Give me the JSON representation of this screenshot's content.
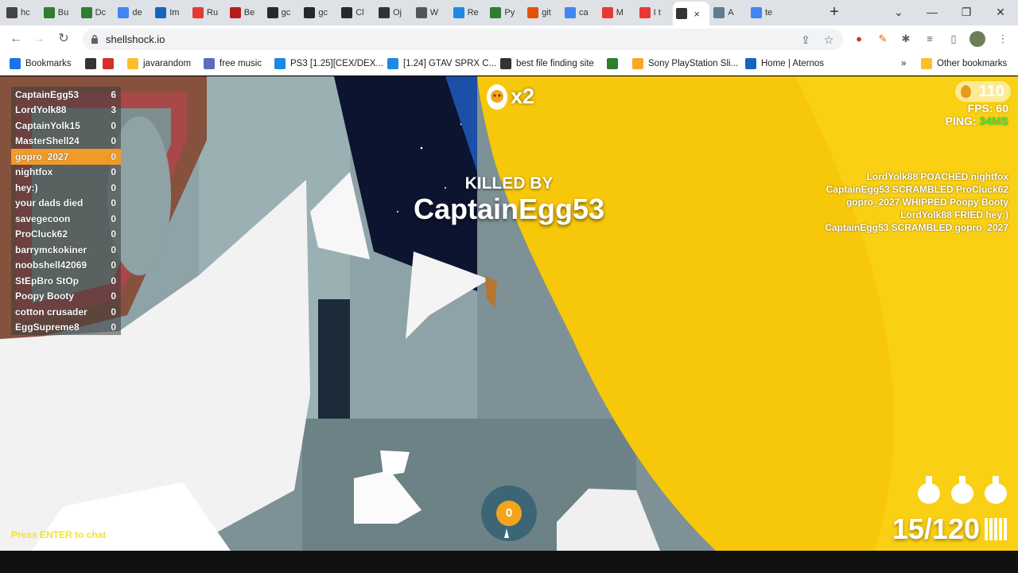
{
  "browser": {
    "tabs": [
      {
        "label": "hc",
        "color": "#444"
      },
      {
        "label": "Bu",
        "color": "#2e7d32"
      },
      {
        "label": "Dc",
        "color": "#2e7d32"
      },
      {
        "label": "de",
        "color": "#4285f4"
      },
      {
        "label": "Im",
        "color": "#1565c0"
      },
      {
        "label": "Ru",
        "color": "#e53935"
      },
      {
        "label": "Be",
        "color": "#b71c1c"
      },
      {
        "label": "gc",
        "color": "#24292e"
      },
      {
        "label": "gc",
        "color": "#24292e"
      },
      {
        "label": "Cl",
        "color": "#24292e"
      },
      {
        "label": "Oj",
        "color": "#333"
      },
      {
        "label": "W",
        "color": "#555"
      },
      {
        "label": "Re",
        "color": "#1e88e5"
      },
      {
        "label": "Py",
        "color": "#2e7d32"
      },
      {
        "label": "git",
        "color": "#e65100"
      },
      {
        "label": "ca",
        "color": "#4285f4"
      },
      {
        "label": "M",
        "color": "#e53935"
      },
      {
        "label": "I t",
        "color": "#e53935"
      },
      {
        "label": "",
        "color": "#333"
      },
      {
        "label": "A",
        "color": "#607d8b"
      },
      {
        "label": "te",
        "color": "#4285f4"
      }
    ],
    "url": "shellshock.io",
    "bookmarks": [
      {
        "label": "Bookmarks",
        "color": "#1a73e8"
      },
      {
        "label": "",
        "color": "#333"
      },
      {
        "label": "",
        "color": "#d32f2f"
      },
      {
        "label": "javarandom",
        "color": "#f9c02c"
      },
      {
        "label": "free music",
        "color": "#5c6bc0"
      },
      {
        "label": "PS3 [1.25][CEX/DEX...",
        "color": "#1e88e5"
      },
      {
        "label": "[1.24] GTAV SPRX C...",
        "color": "#1e88e5"
      },
      {
        "label": "best file finding site",
        "color": "#333"
      },
      {
        "label": "",
        "color": "#2e7d32"
      },
      {
        "label": "Sony PlayStation Sli...",
        "color": "#f9a825"
      },
      {
        "label": "Home | Aternos",
        "color": "#1565c0"
      }
    ],
    "other_bookmarks": "Other bookmarks"
  },
  "game": {
    "scoreboard": [
      {
        "name": "CaptainEgg53",
        "score": "6"
      },
      {
        "name": "LordYolk88",
        "score": "3"
      },
      {
        "name": "CaptainYolk15",
        "score": "0"
      },
      {
        "name": "MasterShell24",
        "score": "0"
      },
      {
        "name": "gopro_2027",
        "score": "0",
        "me": true
      },
      {
        "name": "nightfox",
        "score": "0"
      },
      {
        "name": "hey:)",
        "score": "0"
      },
      {
        "name": "your dads died",
        "score": "0"
      },
      {
        "name": "savegecoon",
        "score": "0"
      },
      {
        "name": "ProCluck62",
        "score": "0"
      },
      {
        "name": "barrymckokiner",
        "score": "0"
      },
      {
        "name": "noobshell42069",
        "score": "0"
      },
      {
        "name": "StEpBro StOp",
        "score": "0"
      },
      {
        "name": "Poopy Booty",
        "score": "0"
      },
      {
        "name": "cotton crusader",
        "score": "0"
      },
      {
        "name": "EggSupreme8",
        "score": "0"
      }
    ],
    "multiplier": "x2",
    "killed_by_label": "KILLED BY",
    "killer": "CaptainEgg53",
    "golden_eggs": "110",
    "fps": "FPS: 60",
    "ping_label": "PING:",
    "ping_value": "34MS",
    "killfeed": [
      "LordYolk88 POACHED nightfox",
      "CaptainEgg53 SCRAMBLED ProCluck62",
      "gopro_2027 WHIPPED Poopy Booty",
      "LordYolk88 FRIED hey:)",
      "CaptainEgg53 SCRAMBLED gopro_2027"
    ],
    "chat_hint": "Press ENTER to chat",
    "grenades": "0",
    "ammo": "15/120",
    "colors": {
      "accent": "#f19a27",
      "ping_good": "#3fe23f",
      "chat_hint": "#f3e233",
      "yolk": "#f7c80a"
    }
  }
}
